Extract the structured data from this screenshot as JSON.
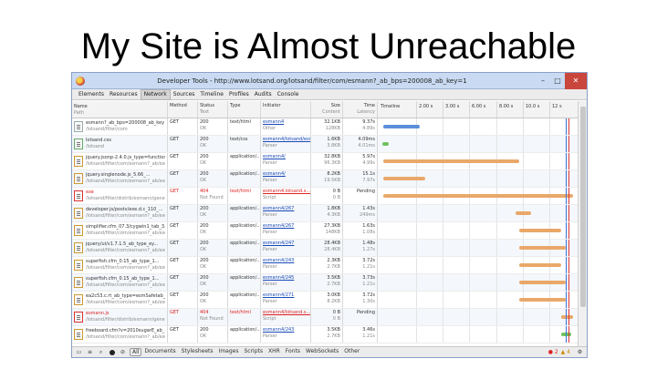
{
  "slide": {
    "title": "My Site is Almost Unreachable"
  },
  "window": {
    "title": "Developer Tools - http://www.lotsand.org/lotsand/filter/com/esmann?_ab_bps=200008_ab_key=1",
    "minimize": "–",
    "maximize": "□",
    "close": "✕"
  },
  "tabs": [
    {
      "label": "Elements"
    },
    {
      "label": "Resources"
    },
    {
      "label": "Network"
    },
    {
      "label": "Sources"
    },
    {
      "label": "Timeline"
    },
    {
      "label": "Profiles"
    },
    {
      "label": "Audits"
    },
    {
      "label": "Console"
    }
  ],
  "columns": {
    "name": "Name",
    "path": "Path",
    "method": "Method",
    "status": "Status",
    "status_sub": "Text",
    "type": "Type",
    "initiator": "Initiator",
    "size": "Size",
    "size_sub": "Content",
    "time": "Time",
    "time_sub": "Latency",
    "timeline": "Timeline"
  },
  "timeline_ticks": [
    "2.00 s",
    "3.00 s",
    "6.00 s",
    "8.00 s",
    "10.0 s",
    "12 s"
  ],
  "rows": [
    {
      "name": "esmann?_ab_bps=200008_ab_key",
      "path": "/lotsand/filter/com",
      "method": "GET",
      "status": "200",
      "status_sub": "OK",
      "type": "text/html",
      "initiator": "esmann4",
      "initiator_sub": "Other",
      "size": "32.1KB",
      "size_sub": "128KB",
      "time": "9.37s",
      "time_sub": "4.89s",
      "icon": "doc-icon",
      "error": false
    },
    {
      "name": "lotsand.css",
      "path": "/lotsand",
      "method": "GET",
      "status": "200",
      "status_sub": "OK",
      "type": "text/css",
      "initiator": "esmann4/lotsand/esm",
      "initiator_sub": "Parser",
      "size": "1.6KB",
      "size_sub": "3.8KB",
      "time": "4.09ms",
      "time_sub": "4.01ms",
      "icon": "css-icon",
      "error": false
    },
    {
      "name": "jquery.jsonp-2.4.0.js_type=function",
      "path": "/lotsand/filter/com/esmann?_ab/exe",
      "method": "GET",
      "status": "200",
      "status_sub": "OK",
      "type": "application/...",
      "initiator": "esmann4/",
      "initiator_sub": "Parser",
      "size": "32.8KB",
      "size_sub": "96.3KB",
      "time": "5.97s",
      "time_sub": "4.99s",
      "icon": "js-icon",
      "error": false
    },
    {
      "name": "jquery.singlenode.js_5.66_...",
      "path": "/lotsand/filter/com/esmann?_ab/exe",
      "method": "GET",
      "status": "200",
      "status_sub": "OK",
      "type": "application/...",
      "initiator": "esmann4/",
      "initiator_sub": "Parser",
      "size": "8.2KB",
      "size_sub": "19.5KB",
      "time": "15.1s",
      "time_sub": "7.97s",
      "icon": "js-icon",
      "error": false
    },
    {
      "name": "exe",
      "path": "/lotsand/filter/distrib/esmann/gene",
      "method": "GET",
      "status": "404",
      "status_sub": "Not Found",
      "type": "text/html",
      "initiator": "esmann4.lotsand.s...",
      "initiator_sub": "Script",
      "size": "0 B",
      "size_sub": "0 B",
      "time": "Pending",
      "time_sub": "",
      "icon": "err-icon",
      "error": true
    },
    {
      "name": "developer.js/postv/exe.d.c_110_...",
      "path": "/lotsand/filter/com/esmann?_ab/exe",
      "method": "GET",
      "status": "200",
      "status_sub": "OK",
      "type": "application/...",
      "initiator": "esmann4/267",
      "initiator_sub": "Parser",
      "size": "1.8KB",
      "size_sub": "4.3KB",
      "time": "1.43s",
      "time_sub": "249ms",
      "icon": "js-icon",
      "error": false
    },
    {
      "name": "simplifier.cfm_07.3/cygwin1_tab_3...",
      "path": "/lotsand/filter/com/esmann?_ab/exe",
      "method": "GET",
      "status": "200",
      "status_sub": "OK",
      "type": "application/...",
      "initiator": "esmann4/267",
      "initiator_sub": "Parser",
      "size": "27.3KB",
      "size_sub": "148KB",
      "time": "1.63s",
      "time_sub": "1.08s",
      "icon": "js-icon",
      "error": false
    },
    {
      "name": "jquery/ui/v1.7.1.5_ab_type_ey...",
      "path": "/lotsand/filter/com/esmann?_ab/exe",
      "method": "GET",
      "status": "200",
      "status_sub": "OK",
      "type": "application/...",
      "initiator": "esmann4/247",
      "initiator_sub": "Parser",
      "size": "28.4KB",
      "size_sub": "28.4KB",
      "time": "1.48s",
      "time_sub": "1.27s",
      "icon": "js-icon",
      "error": false
    },
    {
      "name": "superfish.cfm_0.15_ab_type_1...",
      "path": "/lotsand/filter/com/esmann?_ab/exe",
      "method": "GET",
      "status": "200",
      "status_sub": "OK",
      "type": "application/...",
      "initiator": "esmann4/243",
      "initiator_sub": "Parser",
      "size": "2.3KB",
      "size_sub": "2.7KB",
      "time": "3.72s",
      "time_sub": "1.21s",
      "icon": "js-icon",
      "error": false
    },
    {
      "name": "superfish.cfm_0.15_ab_type_1...",
      "path": "/lotsand/filter/com/esmann?_ab/exe",
      "method": "GET",
      "status": "200",
      "status_sub": "OK",
      "type": "application/...",
      "initiator": "esmann4/245",
      "initiator_sub": "Parser",
      "size": "3.5KB",
      "size_sub": "2.7KB",
      "time": "3.73s",
      "time_sub": "1.21s",
      "icon": "js-icon",
      "error": false
    },
    {
      "name": "ea2c53.c.rt_ab_type=esmSafetab_a...",
      "path": "/lotsand/filter/com/esmann?_ab/exe",
      "method": "GET",
      "status": "200",
      "status_sub": "OK",
      "type": "application/...",
      "initiator": "esmann4/271",
      "initiator_sub": "Parser",
      "size": "3.0KB",
      "size_sub": "8.2KB",
      "time": "3.72s",
      "time_sub": "1.30s",
      "icon": "js-icon",
      "error": false
    },
    {
      "name": "esmann.js",
      "path": "/lotsand/filter/distrib/esmann/gene",
      "method": "GET",
      "status": "404",
      "status_sub": "Not Found",
      "type": "text/html",
      "initiator": "esmann4/lotsand.s...",
      "initiator_sub": "Script",
      "size": "0 B",
      "size_sub": "0 B",
      "time": "Pending",
      "time_sub": "",
      "icon": "err-icon",
      "error": true
    },
    {
      "name": "freeboard.cfm?v=2010sugarE_ab_...",
      "path": "/lotsand/filter/com/esmann?_ab/exe",
      "method": "GET",
      "status": "200",
      "status_sub": "OK",
      "type": "application/...",
      "initiator": "esmann4/243",
      "initiator_sub": "Parser",
      "size": "3.5KB",
      "size_sub": "2.7KB",
      "time": "3.46s",
      "time_sub": "1.21s",
      "icon": "js-icon",
      "error": false
    }
  ],
  "timeline_bars": [
    {
      "start": 0.01,
      "end": 0.2,
      "color": "blue",
      "label": ""
    },
    {
      "start": 0.005,
      "end": 0.04,
      "color": "green",
      "label": ""
    },
    {
      "start": 0.01,
      "end": 0.72,
      "color": "orange",
      "label": ""
    },
    {
      "start": 0.01,
      "end": 0.23,
      "color": "orange",
      "label": ""
    },
    {
      "start": 0.01,
      "end": 1.0,
      "color": "orange",
      "label": ""
    },
    {
      "start": 0.7,
      "end": 0.78,
      "color": "orange",
      "label": ""
    },
    {
      "start": 0.72,
      "end": 0.94,
      "color": "orange",
      "label": ""
    },
    {
      "start": 0.72,
      "end": 0.96,
      "color": "orange",
      "label": ""
    },
    {
      "start": 0.72,
      "end": 0.94,
      "color": "orange",
      "label": ""
    },
    {
      "start": 0.72,
      "end": 0.96,
      "color": "orange",
      "label": ""
    },
    {
      "start": 0.72,
      "end": 0.96,
      "color": "orange",
      "label": ""
    },
    {
      "start": 0.94,
      "end": 1.0,
      "color": "orange",
      "label": ""
    },
    {
      "start": 0.94,
      "end": 0.99,
      "color": "green",
      "label": ""
    }
  ],
  "statusbar": {
    "filters": [
      "All",
      "Documents",
      "Stylesheets",
      "Images",
      "Scripts",
      "XHR",
      "Fonts",
      "WebSockets",
      "Other"
    ],
    "errors": "● 2",
    "warnings": "▲ 4"
  },
  "colors": {
    "error": "#dd2222",
    "timeline_blue": "#5b8fdc",
    "timeline_green": "#6fc35f",
    "timeline_orange": "#e9a86a"
  }
}
